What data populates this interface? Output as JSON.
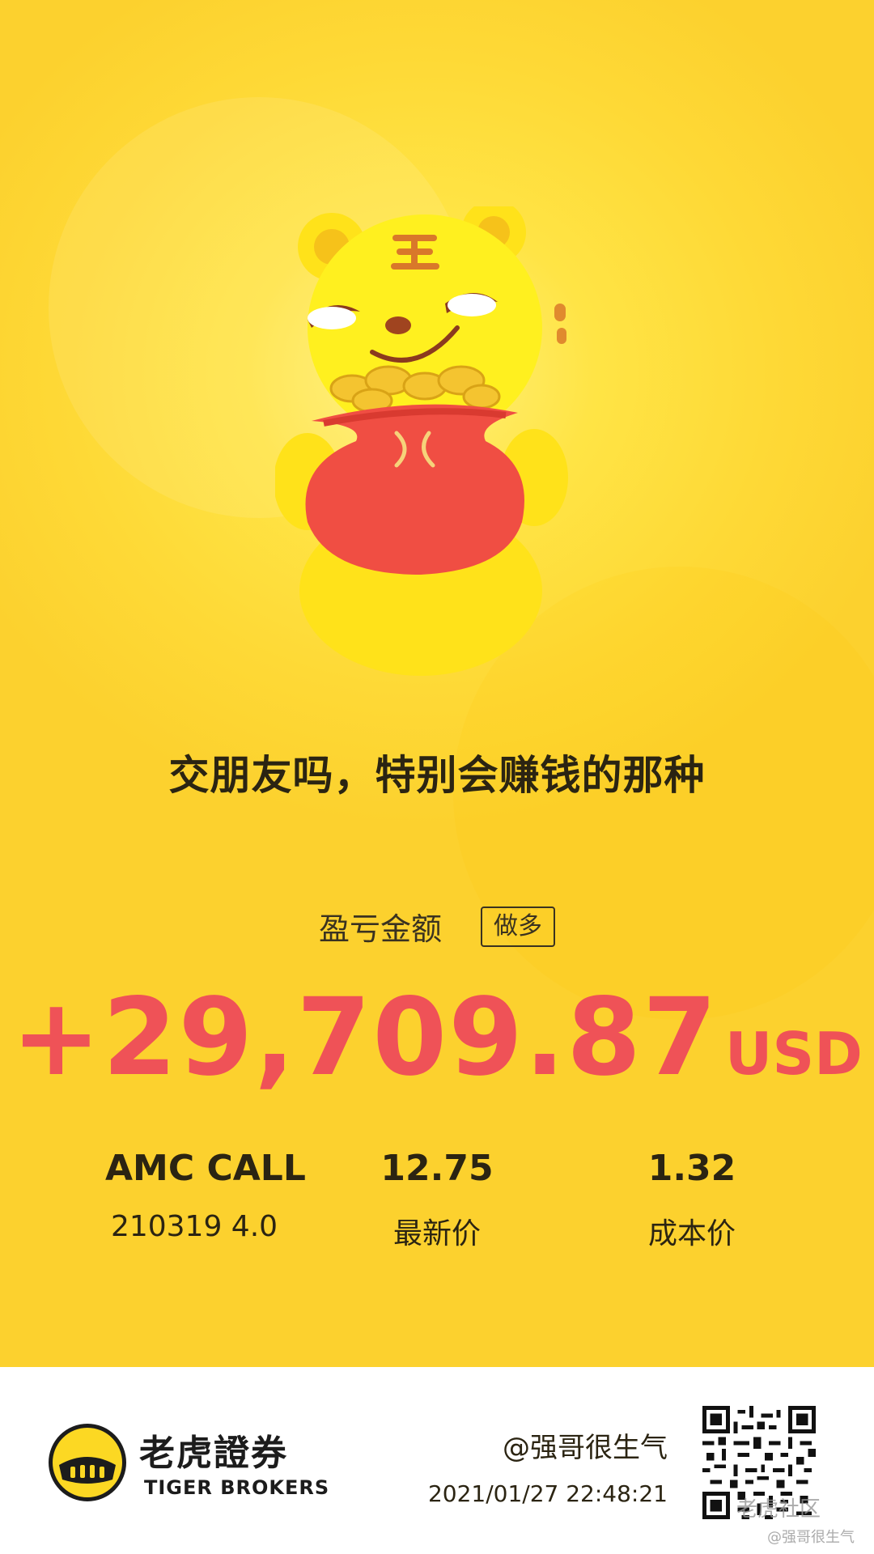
{
  "slogan": "交朋友吗，特别会赚钱的那种",
  "pnl": {
    "label": "盈亏金额",
    "direction_badge": "做多",
    "amount": "+29,709.87",
    "currency": "USD"
  },
  "position": {
    "symbol": "AMC CALL",
    "contract": "210319 4.0",
    "latest_price": "12.75",
    "latest_price_label": "最新价",
    "cost_price": "1.32",
    "cost_price_label": "成本价"
  },
  "footer": {
    "brand_cn": "老虎證券",
    "brand_en": "TIGER BROKERS",
    "user_handle": "@强哥很生气",
    "timestamp": "2021/01/27 22:48:21",
    "watermark_community": "老虎社区",
    "watermark_handle": "@强哥很生气"
  },
  "colors": {
    "background": "#fed936",
    "profit": "#ef5257",
    "text": "#2b2412"
  },
  "icons": {
    "mascot": "tiger-mascot-with-coin-bag",
    "logo": "tiger-brokers-logo",
    "qr": "qr-code"
  }
}
